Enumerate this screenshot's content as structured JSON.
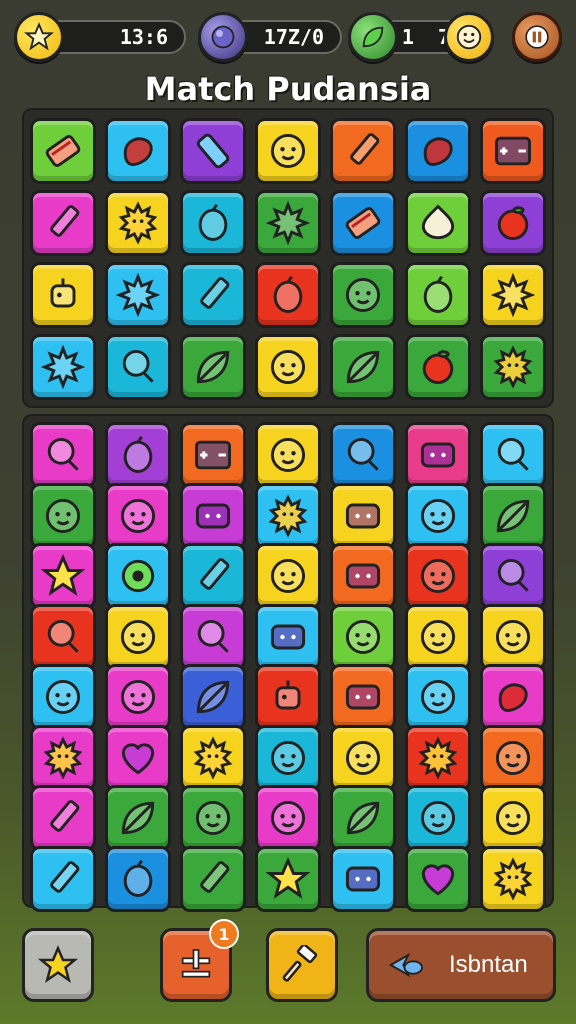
{
  "title": "Match Pudansia",
  "hud": {
    "coins": "13:6",
    "gems": "17Z/0",
    "leaves": "1  7"
  },
  "bottom_bar": {
    "action_label": "Isbntan",
    "shuffle_badge": "1"
  },
  "icon_names": {
    "coin": "star-coin-icon",
    "gem": "orb-icon",
    "leaf": "leaf-icon",
    "face": "happy-face-icon",
    "pause": "pause-icon"
  },
  "tiles_top": [
    [
      {
        "c": "#6fcf3a",
        "i": "bacon"
      },
      {
        "c": "#2ec0f0",
        "i": "blob"
      },
      {
        "c": "#8e3fd6",
        "i": "battery"
      },
      {
        "c": "#f6d31f",
        "i": "face"
      },
      {
        "c": "#f26a1f",
        "i": "pencil"
      },
      {
        "c": "#1b8fe0",
        "i": "blob"
      },
      {
        "c": "#f05a1e",
        "i": "console"
      }
    ],
    [
      {
        "c": "#e83cc8",
        "i": "pencil"
      },
      {
        "c": "#f6d31f",
        "i": "sun"
      },
      {
        "c": "#1bb7d9",
        "i": "berry"
      },
      {
        "c": "#3aa83a",
        "i": "splat"
      },
      {
        "c": "#1b8fe0",
        "i": "bacon"
      },
      {
        "c": "#6fcf3a",
        "i": "garlic"
      },
      {
        "c": "#8e3fd6",
        "i": "apple"
      }
    ],
    [
      {
        "c": "#f6d31f",
        "i": "robot"
      },
      {
        "c": "#2ec0f0",
        "i": "splat"
      },
      {
        "c": "#1bb7d9",
        "i": "pencil"
      },
      {
        "c": "#e8341e",
        "i": "berry"
      },
      {
        "c": "#3aa83a",
        "i": "face"
      },
      {
        "c": "#6fcf3a",
        "i": "berry"
      },
      {
        "c": "#f6d31f",
        "i": "splat"
      }
    ],
    [
      {
        "c": "#2ec0f0",
        "i": "splat"
      },
      {
        "c": "#1bb7d9",
        "i": "lolly"
      },
      {
        "c": "#3aa83a",
        "i": "leaf"
      },
      {
        "c": "#f6d31f",
        "i": "face"
      },
      {
        "c": "#3aa83a",
        "i": "leaf"
      },
      {
        "c": "#3aa83a",
        "i": "apple"
      },
      {
        "c": "#3aa83a",
        "i": "sun"
      }
    ]
  ],
  "tiles_bottom": [
    [
      {
        "c": "#e83cc8",
        "i": "lolly"
      },
      {
        "c": "#a43fd6",
        "i": "berry"
      },
      {
        "c": "#f26a1f",
        "i": "console"
      },
      {
        "c": "#f6d31f",
        "i": "face"
      },
      {
        "c": "#1b8fe0",
        "i": "lolly"
      },
      {
        "c": "#e83c8a",
        "i": "box"
      },
      {
        "c": "#2ec0f0",
        "i": "lolly"
      }
    ],
    [
      {
        "c": "#3aa83a",
        "i": "face"
      },
      {
        "c": "#e83cc8",
        "i": "face"
      },
      {
        "c": "#c83cd6",
        "i": "box"
      },
      {
        "c": "#2ec0f0",
        "i": "sun"
      },
      {
        "c": "#f6d31f",
        "i": "box"
      },
      {
        "c": "#2ec0f0",
        "i": "face"
      },
      {
        "c": "#3aa83a",
        "i": "leaf"
      }
    ],
    [
      {
        "c": "#e83cc8",
        "i": "star"
      },
      {
        "c": "#2ec0f0",
        "i": "eye"
      },
      {
        "c": "#1bb7d9",
        "i": "pencil"
      },
      {
        "c": "#f6d31f",
        "i": "face"
      },
      {
        "c": "#f26a1f",
        "i": "box"
      },
      {
        "c": "#e8341e",
        "i": "face"
      },
      {
        "c": "#8e3fd6",
        "i": "lolly"
      }
    ],
    [
      {
        "c": "#e8341e",
        "i": "lolly"
      },
      {
        "c": "#f6d31f",
        "i": "face"
      },
      {
        "c": "#c83cd6",
        "i": "lolly"
      },
      {
        "c": "#2ec0f0",
        "i": "box"
      },
      {
        "c": "#6fcf3a",
        "i": "face"
      },
      {
        "c": "#f6d31f",
        "i": "face"
      },
      {
        "c": "#f6d31f",
        "i": "face"
      }
    ],
    [
      {
        "c": "#2ec0f0",
        "i": "face"
      },
      {
        "c": "#e83cc8",
        "i": "face"
      },
      {
        "c": "#3b5fd6",
        "i": "leaf"
      },
      {
        "c": "#e8341e",
        "i": "robot"
      },
      {
        "c": "#f26a1f",
        "i": "box"
      },
      {
        "c": "#2ec0f0",
        "i": "face"
      },
      {
        "c": "#e83cc8",
        "i": "blob"
      }
    ],
    [
      {
        "c": "#e83cc8",
        "i": "sun"
      },
      {
        "c": "#e83cc8",
        "i": "heart"
      },
      {
        "c": "#f6d31f",
        "i": "sun"
      },
      {
        "c": "#1bb7d9",
        "i": "face"
      },
      {
        "c": "#f6d31f",
        "i": "face"
      },
      {
        "c": "#e8341e",
        "i": "sun"
      },
      {
        "c": "#f26a1f",
        "i": "face"
      }
    ],
    [
      {
        "c": "#e83cc8",
        "i": "pencil"
      },
      {
        "c": "#3aa83a",
        "i": "leaf"
      },
      {
        "c": "#3aa83a",
        "i": "face"
      },
      {
        "c": "#e83cc8",
        "i": "face"
      },
      {
        "c": "#3aa83a",
        "i": "leaf"
      },
      {
        "c": "#1bb7d9",
        "i": "face"
      },
      {
        "c": "#f6d31f",
        "i": "face"
      }
    ],
    [
      {
        "c": "#2ec0f0",
        "i": "pencil"
      },
      {
        "c": "#1b8fe0",
        "i": "berry"
      },
      {
        "c": "#3aa83a",
        "i": "pencil"
      },
      {
        "c": "#3aa83a",
        "i": "star"
      },
      {
        "c": "#2ec0f0",
        "i": "box"
      },
      {
        "c": "#3aa83a",
        "i": "heart"
      },
      {
        "c": "#f6d31f",
        "i": "sun"
      }
    ]
  ]
}
